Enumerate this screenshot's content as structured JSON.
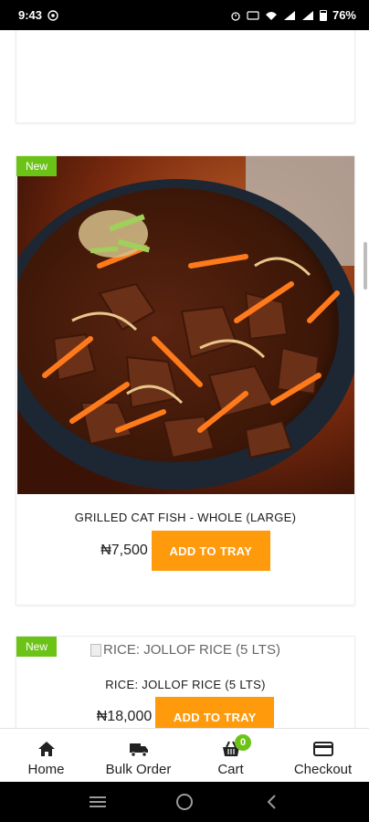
{
  "status_bar": {
    "time": "9:43",
    "battery": "76%"
  },
  "products": [
    {
      "badge": "New",
      "title": "GRILLED CAT FISH - WHOLE (LARGE)",
      "price": "₦7,500",
      "button_label": "ADD TO TRAY",
      "image_icon": "grilled-dish-photo"
    },
    {
      "badge": "New",
      "image_alt": "RICE: JOLLOF RICE (5 LTS)",
      "title": "RICE: JOLLOF RICE (5 LTS)",
      "price": "₦18,000",
      "button_label": "ADD TO TRAY"
    }
  ],
  "bottom_nav": {
    "items": [
      {
        "label": "Home",
        "icon": "home-icon"
      },
      {
        "label": "Bulk Order",
        "icon": "truck-icon"
      },
      {
        "label": "Cart",
        "icon": "basket-icon",
        "badge": "0"
      },
      {
        "label": "Checkout",
        "icon": "credit-card-icon"
      }
    ]
  },
  "colors": {
    "accent_orange": "#ff9a0d",
    "badge_green": "#6cc318"
  }
}
